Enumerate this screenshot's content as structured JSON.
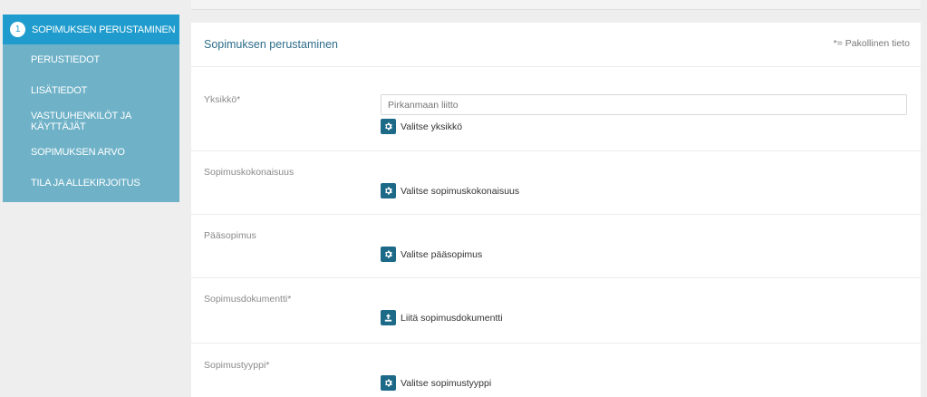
{
  "sidebar": {
    "items": [
      {
        "step": "1",
        "label": "SOPIMUKSEN PERUSTAMINEN",
        "active": true
      },
      {
        "label": "PERUSTIEDOT"
      },
      {
        "label": "LISÄTIEDOT"
      },
      {
        "label": "VASTUUHENKILÖT JA KÄYTTÄJÄT"
      },
      {
        "label": "SOPIMUKSEN ARVO"
      },
      {
        "label": "TILA JA ALLEKIRJOITUS"
      }
    ]
  },
  "panel": {
    "title": "Sopimuksen perustaminen",
    "required_note": "*= Pakollinen tieto"
  },
  "form": {
    "yksikko": {
      "label": "Yksikkö*",
      "placeholder": "Pirkanmaan liitto",
      "action": "Valitse yksikkö",
      "icon": "gear-icon"
    },
    "kokonaisuus": {
      "label": "Sopimuskokonaisuus",
      "action": "Valitse sopimuskokonaisuus",
      "icon": "gear-icon"
    },
    "paasopimus": {
      "label": "Pääsopimus",
      "action": "Valitse pääsopimus",
      "icon": "gear-icon"
    },
    "dokumentti": {
      "label": "Sopimusdokumentti*",
      "action": "Liitä sopimusdokumentti",
      "icon": "upload-icon"
    },
    "tyyppi": {
      "label": "Sopimustyyppi*",
      "action": "Valitse sopimustyyppi",
      "icon": "gear-icon"
    }
  },
  "colors": {
    "sidebar_bg": "#6fb2c8",
    "sidebar_active": "#1f9ccd",
    "icon_button": "#1d6a88",
    "title": "#2e6d8a"
  }
}
